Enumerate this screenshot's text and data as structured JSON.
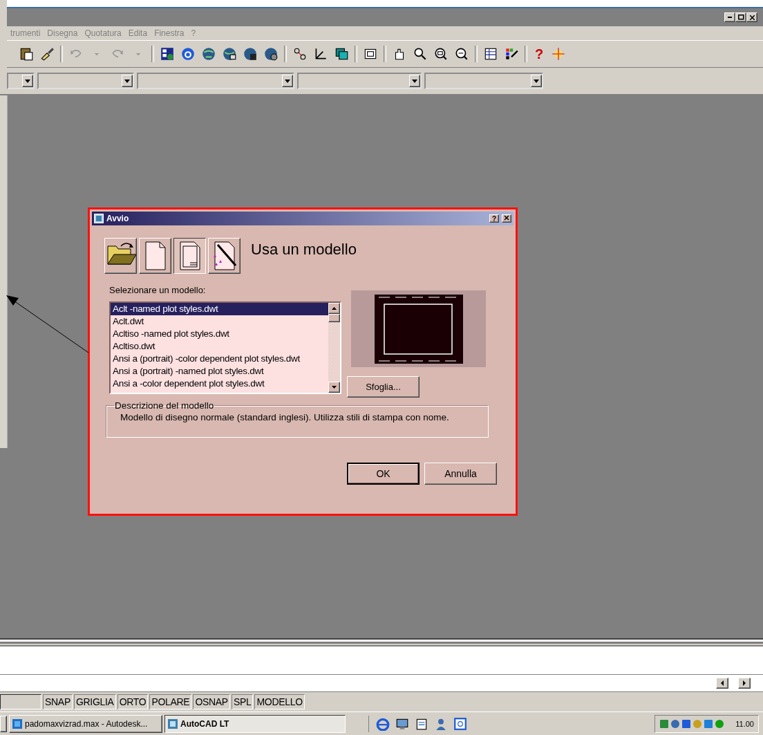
{
  "menu": [
    "trumenti",
    "Disegna",
    "Quotatura",
    "Edita",
    "Finestra",
    "?"
  ],
  "toolbar": {
    "help_button": "?"
  },
  "dialog": {
    "title": "Avvio",
    "help_button": "?",
    "options": [
      {
        "kind": "open",
        "selected": false
      },
      {
        "kind": "blank",
        "selected": false
      },
      {
        "kind": "template",
        "selected": true
      },
      {
        "kind": "wizard",
        "selected": false
      }
    ],
    "heading": "Usa un modello",
    "list_label": "Selezionare un modello:",
    "templates": [
      {
        "label": "Aclt -named plot styles.dwt",
        "selected": true
      },
      {
        "label": "Aclt.dwt",
        "selected": false
      },
      {
        "label": "Acltiso -named plot styles.dwt",
        "selected": false
      },
      {
        "label": "Acltiso.dwt",
        "selected": false
      },
      {
        "label": "Ansi a (portrait) -color dependent plot styles.dwt",
        "selected": false
      },
      {
        "label": "Ansi a (portrait) -named plot styles.dwt",
        "selected": false
      },
      {
        "label": "Ansi a -color dependent plot styles.dwt",
        "selected": false
      }
    ],
    "browse_button": "Sfoglia...",
    "description": {
      "legend": "Descrizione del modello",
      "text": "Modello di disegno normale (standard inglesi). Utilizza stili di stampa con nome."
    },
    "buttons": [
      {
        "label": "OK",
        "default": true
      },
      {
        "label": "Annulla",
        "default": false
      }
    ]
  },
  "status_bar": {
    "toggles": [
      "SNAP",
      "GRIGLIA",
      "ORTO",
      "POLARE",
      "OSNAP",
      "SPL",
      "MODELLO"
    ]
  },
  "taskbar": {
    "tasks": [
      {
        "label": "padomaxvizrad.max - Autodesk...",
        "selected": false
      },
      {
        "label": "AutoCAD LT",
        "selected": true
      }
    ],
    "clock": "11.00"
  }
}
